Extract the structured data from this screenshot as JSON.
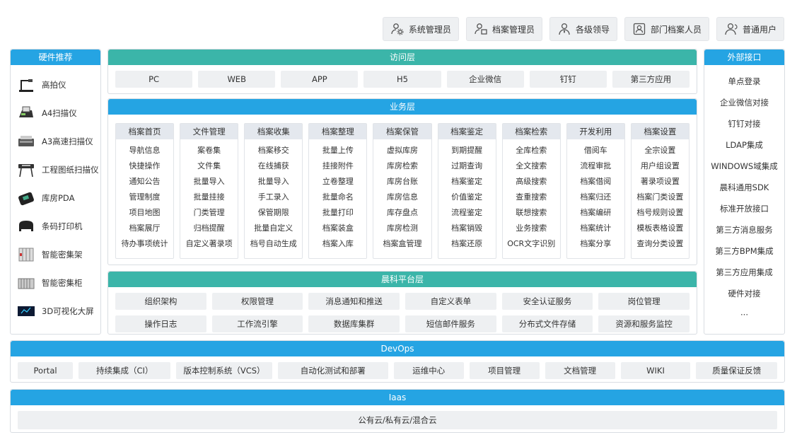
{
  "roles": [
    {
      "label": "系统管理员",
      "icon": "admin-gear-icon"
    },
    {
      "label": "档案管理员",
      "icon": "archive-admin-icon"
    },
    {
      "label": "各级领导",
      "icon": "leader-icon"
    },
    {
      "label": "部门档案人员",
      "icon": "department-staff-icon"
    },
    {
      "label": "普通用户",
      "icon": "user-icon"
    }
  ],
  "hardware": {
    "title": "硬件推荐",
    "items": [
      {
        "label": "高拍仪",
        "icon": "document-camera-icon"
      },
      {
        "label": "A4扫描仪",
        "icon": "a4-scanner-icon"
      },
      {
        "label": "A3高速扫描仪",
        "icon": "a3-scanner-icon"
      },
      {
        "label": "工程图纸扫描仪",
        "icon": "plotter-scanner-icon"
      },
      {
        "label": "库房PDA",
        "icon": "pda-icon"
      },
      {
        "label": "条码打印机",
        "icon": "barcode-printer-icon"
      },
      {
        "label": "智能密集架",
        "icon": "shelving-icon"
      },
      {
        "label": "智能密集柜",
        "icon": "cabinet-icon"
      },
      {
        "label": "3D可视化大屏",
        "icon": "big-screen-icon"
      }
    ]
  },
  "external": {
    "title": "外部接口",
    "items": [
      "单点登录",
      "企业微信对接",
      "钉钉对接",
      "LDAP集成",
      "WINDOWS域集成",
      "晨科通用SDK",
      "标准开放接口",
      "第三方消息服务",
      "第三方BPM集成",
      "第三方应用集成",
      "硬件对接",
      "···"
    ]
  },
  "access": {
    "title": "访问层",
    "items": [
      "PC",
      "WEB",
      "APP",
      "H5",
      "企业微信",
      "钉钉",
      "第三方应用"
    ]
  },
  "business": {
    "title": "业务层",
    "columns": [
      {
        "title": "档案首页",
        "items": [
          "导航信息",
          "快捷操作",
          "通知公告",
          "管理制度",
          "项目地图",
          "档案展厅",
          "待办事项统计"
        ]
      },
      {
        "title": "文件管理",
        "items": [
          "案卷集",
          "文件集",
          "批量导入",
          "批量挂接",
          "门类管理",
          "归档提醒",
          "自定义著录项"
        ]
      },
      {
        "title": "档案收集",
        "items": [
          "档案移交",
          "在线捕获",
          "批量导入",
          "手工录入",
          "保管期限",
          "批量自定义",
          "档号自动生成"
        ]
      },
      {
        "title": "档案整理",
        "items": [
          "批量上传",
          "挂接附件",
          "立卷整理",
          "批量命名",
          "批量打印",
          "档案装盒",
          "档案入库"
        ]
      },
      {
        "title": "档案保管",
        "items": [
          "虚拟库房",
          "库房检索",
          "库房台账",
          "库房信息",
          "库存盘点",
          "库房检测",
          "档案盒管理"
        ]
      },
      {
        "title": "档案鉴定",
        "items": [
          "到期提醒",
          "过期查询",
          "档案鉴定",
          "价值鉴定",
          "流程鉴定",
          "档案销毁",
          "档案还原"
        ]
      },
      {
        "title": "档案检索",
        "items": [
          "全库检索",
          "全文搜索",
          "高级搜索",
          "查重搜索",
          "联想搜索",
          "业务搜索",
          "OCR文字识别"
        ]
      },
      {
        "title": "开发利用",
        "items": [
          "借阅车",
          "流程审批",
          "档案借阅",
          "档案归还",
          "档案编研",
          "档案统计",
          "档案分享"
        ]
      },
      {
        "title": "档案设置",
        "items": [
          "全宗设置",
          "用户组设置",
          "著录项设置",
          "档案门类设置",
          "档号规则设置",
          "模板表格设置",
          "查询分类设置"
        ]
      }
    ]
  },
  "platform": {
    "title": "晨科平台层",
    "items": [
      "组织架构",
      "权限管理",
      "消息通知和推送",
      "自定义表单",
      "安全认证服务",
      "岗位管理",
      "操作日志",
      "工作流引擎",
      "数据库集群",
      "短信邮件服务",
      "分布式文件存储",
      "资源和服务监控"
    ]
  },
  "devops": {
    "title": "DevOps",
    "items": [
      "Portal",
      "持续集成（CI）",
      "版本控制系统（VCS）",
      "自动化测试和部署",
      "运维中心",
      "项目管理",
      "文档管理",
      "WIKI",
      "质量保证反馈"
    ]
  },
  "iaas": {
    "title": "Iaas",
    "item": "公有云/私有云/混合云"
  },
  "colors": {
    "blue_header": "#25a4e3",
    "teal_header": "#3bb5a9",
    "chip_bg": "#eef0f2"
  }
}
